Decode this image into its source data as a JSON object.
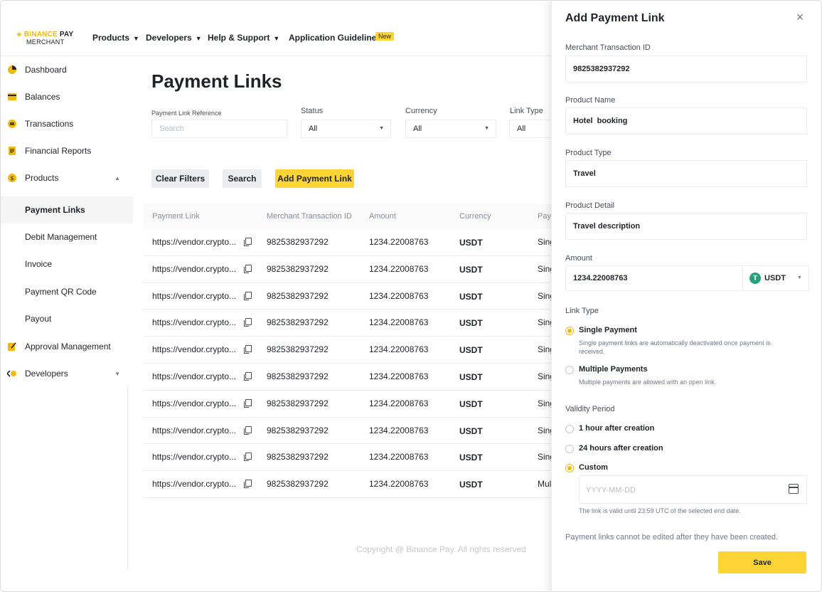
{
  "brand": {
    "line1_prefix": "BINANCE",
    "line1_suffix": "PAY",
    "line2": "MERCHANT"
  },
  "nav": {
    "products": "Products",
    "developers": "Developers",
    "help": "Help & Support",
    "guidelines": "Application Guidelines",
    "new_badge": "New"
  },
  "sidebar": {
    "dashboard": "Dashboard",
    "balances": "Balances",
    "transactions": "Transactions",
    "financial_reports": "Financial Reports",
    "products": "Products",
    "payment_links": "Payment Links",
    "debit_management": "Debit Management",
    "invoice": "Invoice",
    "payment_qr": "Payment QR Code",
    "payout": "Payout",
    "approval": "Approval Management",
    "developers": "Developers"
  },
  "main": {
    "title": "Payment Links",
    "filters": {
      "ref_label": "Payment Link Reference",
      "ref_placeholder": "Search",
      "status_label": "Status",
      "status_value": "All",
      "currency_label": "Currency",
      "currency_value": "All",
      "linktype_label": "Link Type",
      "linktype_value": "All"
    },
    "buttons": {
      "clear": "Clear Filters",
      "search": "Search",
      "add": "Add Payment Link"
    },
    "table": {
      "headers": {
        "link": "Payment Link",
        "mtid": "Merchant Transaction ID",
        "amount": "Amount",
        "currency": "Currency",
        "type": "Pay"
      },
      "rows": [
        {
          "link": "https://vendor.crypto...",
          "mtid": "9825382937292",
          "amount": "1234.22008763",
          "currency": "USDT",
          "type": "Sing"
        },
        {
          "link": "https://vendor.crypto...",
          "mtid": "9825382937292",
          "amount": "1234.22008763",
          "currency": "USDT",
          "type": "Sing"
        },
        {
          "link": "https://vendor.crypto...",
          "mtid": "9825382937292",
          "amount": "1234.22008763",
          "currency": "USDT",
          "type": "Sing"
        },
        {
          "link": "https://vendor.crypto...",
          "mtid": "9825382937292",
          "amount": "1234.22008763",
          "currency": "USDT",
          "type": "Sing"
        },
        {
          "link": "https://vendor.crypto...",
          "mtid": "9825382937292",
          "amount": "1234.22008763",
          "currency": "USDT",
          "type": "Sing"
        },
        {
          "link": "https://vendor.crypto...",
          "mtid": "9825382937292",
          "amount": "1234.22008763",
          "currency": "USDT",
          "type": "Sing"
        },
        {
          "link": "https://vendor.crypto...",
          "mtid": "9825382937292",
          "amount": "1234.22008763",
          "currency": "USDT",
          "type": "Sing"
        },
        {
          "link": "https://vendor.crypto...",
          "mtid": "9825382937292",
          "amount": "1234.22008763",
          "currency": "USDT",
          "type": "Sing"
        },
        {
          "link": "https://vendor.crypto...",
          "mtid": "9825382937292",
          "amount": "1234.22008763",
          "currency": "USDT",
          "type": "Sing"
        },
        {
          "link": "https://vendor.crypto...",
          "mtid": "9825382937292",
          "amount": "1234.22008763",
          "currency": "USDT",
          "type": "Mul"
        }
      ]
    },
    "footer": "Copyright @ Binance Pay. All rights reserved"
  },
  "drawer": {
    "title": "Add Payment Link",
    "close_icon": "×",
    "mtid_label": "Merchant Transaction ID",
    "mtid_value": "9825382937292",
    "product_name_label": "Product Name",
    "product_name_value": "Hotel  booking",
    "product_type_label": "Product Type",
    "product_type_value": "Travel",
    "product_detail_label": "Product Detail",
    "product_detail_value": "Travel description",
    "amount_label": "Amount",
    "amount_value": "1234.22008763",
    "currency_symbol": "T",
    "currency": "USDT",
    "link_type_label": "Link Type",
    "single_label": "Single Payment",
    "single_desc": "Single payment links are automatically deactivated once payment is received.",
    "multiple_label": "Multiple Payments",
    "multiple_desc": "Multiple payments are allowed with an open link.",
    "validity_label": "Validity Period",
    "opt_1h": "1 hour after creation",
    "opt_24h": "24 hours after creation",
    "opt_custom": "Custom",
    "date_placeholder": "YYYY-MM-DD",
    "date_note": "The link is valid until 23:59 UTC of the selected end date.",
    "warning": "Payment links cannot be edited after they have been created.",
    "save": "Save"
  },
  "colors": {
    "accent": "#fcd535",
    "accent_dark": "#f0b90b",
    "tether": "#26a17b"
  }
}
